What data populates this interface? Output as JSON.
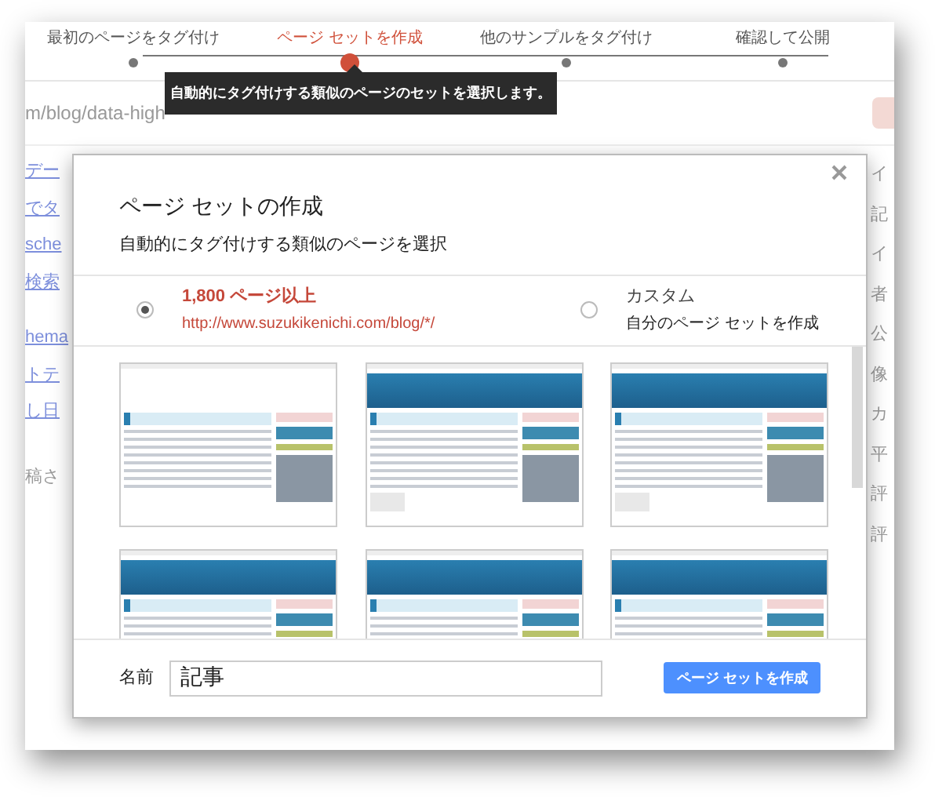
{
  "steps": [
    {
      "label": "最初のページをタグ付け",
      "selected": false
    },
    {
      "label": "ページ セットを作成",
      "selected": true
    },
    {
      "label": "他のサンプルをタグ付け",
      "selected": false
    },
    {
      "label": "確認して公開",
      "selected": false
    }
  ],
  "tooltip": "自動的にタグ付けする類似のページのセットを選択します。",
  "background": {
    "url": "m/blog/data-high",
    "left_links": [
      "デー",
      "でタ",
      "sche",
      "検索",
      "hema",
      "トテ",
      "し日"
    ],
    "left_text": "稿さ",
    "right_labels": [
      "イ",
      "記",
      "イ",
      "者",
      "公",
      "像",
      "カ",
      "平",
      "評",
      "評"
    ]
  },
  "dialog": {
    "title": "ページ セットの作成",
    "subtitle": "自動的にタグ付けする類似のページを選択",
    "options": [
      {
        "title": "1,800 ページ以上",
        "detail": "http://www.suzukikenichi.com/blog/*/",
        "selected": true
      },
      {
        "title": "カスタム",
        "detail": "自分のページ セットを作成",
        "selected": false
      }
    ],
    "thumbnails": [
      {
        "kind": "plain"
      },
      {
        "kind": "header"
      },
      {
        "kind": "header"
      },
      {
        "kind": "header"
      },
      {
        "kind": "header"
      },
      {
        "kind": "header"
      }
    ],
    "name_label": "名前",
    "name_value": "記事",
    "create_button": "ページ セットを作成"
  }
}
